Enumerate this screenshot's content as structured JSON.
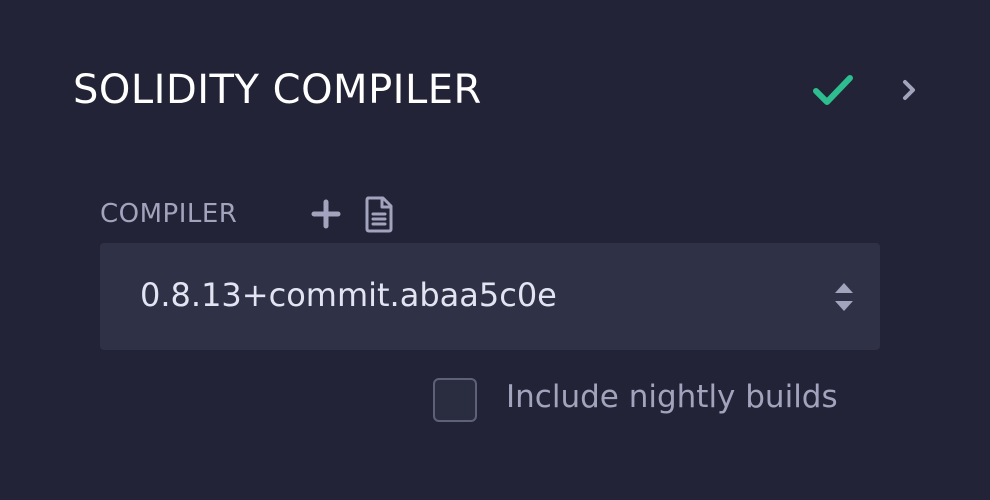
{
  "header": {
    "title": "SOLIDITY COMPILER",
    "status_icon": "check-icon",
    "status_color": "#2ebd8f",
    "collapse_icon": "chevron-right-icon"
  },
  "compiler": {
    "label": "COMPILER",
    "add_icon": "plus-icon",
    "file_icon": "file-icon",
    "selected_version": "0.8.13+commit.abaa5c0e",
    "nightly_label": "Include nightly builds",
    "nightly_checked": false
  },
  "colors": {
    "background": "#222336",
    "input_background": "#2f3147",
    "muted_text": "#a2a3bd",
    "accent_green": "#2ebd8f"
  }
}
